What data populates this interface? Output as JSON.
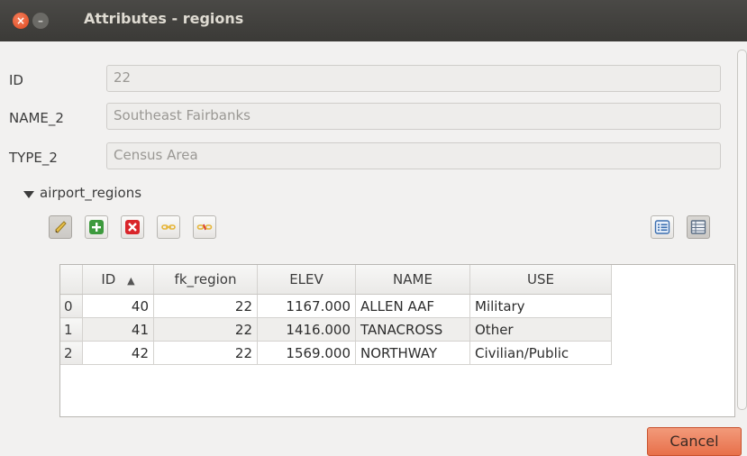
{
  "window": {
    "title": "Attributes - regions",
    "close_glyph": "×",
    "min_glyph": "–"
  },
  "form": {
    "id_label": "ID",
    "id_value": "22",
    "name_label": "NAME_2",
    "name_value": "Southeast Fairbanks",
    "type_label": "TYPE_2",
    "type_value": "Census Area"
  },
  "relation": {
    "title": "airport_regions"
  },
  "toolbar": {
    "icons": [
      "pencil-icon",
      "add-feature-icon",
      "delete-feature-icon",
      "link-feature-icon",
      "unlink-feature-icon",
      "form-view-icon",
      "table-view-icon"
    ]
  },
  "table": {
    "headers": [
      "ID",
      "fk_region",
      "ELEV",
      "NAME",
      "USE"
    ],
    "sort_indicator": "▲",
    "rows": [
      {
        "rownum": "0",
        "id": "40",
        "fk_region": "22",
        "elev": "1167.000",
        "name": "ALLEN AAF",
        "use": "Military"
      },
      {
        "rownum": "1",
        "id": "41",
        "fk_region": "22",
        "elev": "1416.000",
        "name": "TANACROSS",
        "use": "Other"
      },
      {
        "rownum": "2",
        "id": "42",
        "fk_region": "22",
        "elev": "1569.000",
        "name": "NORTHWAY",
        "use": "Civilian/Public"
      }
    ]
  },
  "buttons": {
    "cancel": "Cancel"
  },
  "colors": {
    "titlebar": "#3c3b37",
    "close_button": "#e95420",
    "cancel_button": "#ec7b55"
  }
}
